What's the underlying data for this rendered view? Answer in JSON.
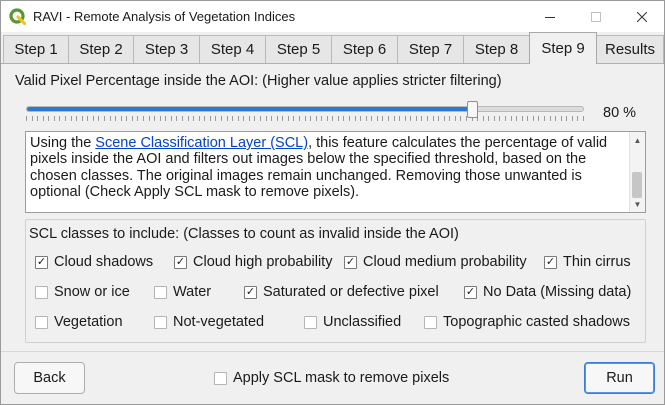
{
  "window": {
    "title": "RAVI - Remote Analysis of Vegetation Indices",
    "minimize_glyph": "—",
    "maximize_glyph": "☐",
    "close_glyph": "✕"
  },
  "tabs": [
    {
      "label": "Step 1",
      "active": false
    },
    {
      "label": "Step 2",
      "active": false
    },
    {
      "label": "Step 3",
      "active": false
    },
    {
      "label": "Step 4",
      "active": false
    },
    {
      "label": "Step 5",
      "active": false
    },
    {
      "label": "Step 6",
      "active": false
    },
    {
      "label": "Step 7",
      "active": false
    },
    {
      "label": "Step 8",
      "active": false
    },
    {
      "label": "Step 9",
      "active": true
    },
    {
      "label": "Results",
      "active": false
    }
  ],
  "threshold": {
    "label": "Valid Pixel Percentage inside the AOI: (Higher value applies stricter filtering)",
    "value_percent": 80,
    "value_text": "80 %"
  },
  "description": {
    "prefix": "Using the ",
    "link_text": "Scene Classification Layer (SCL)",
    "suffix": ", this feature calculates the percentage of valid pixels inside the AOI and filters out images below the specified threshold, based on the chosen classes. The original images remain unchanged. Removing those unwanted is optional (Check Apply SCL mask to remove pixels)."
  },
  "scl_classes": {
    "title": "SCL classes to include: (Classes to count as invalid inside the AOI)",
    "items": [
      {
        "label": "Cloud shadows",
        "checked": true
      },
      {
        "label": "Cloud high probability",
        "checked": true
      },
      {
        "label": "Cloud medium probability",
        "checked": true
      },
      {
        "label": "Thin cirrus",
        "checked": true
      },
      {
        "label": "Snow or ice",
        "checked": false
      },
      {
        "label": "Water",
        "checked": false
      },
      {
        "label": "Saturated or defective pixel",
        "checked": true
      },
      {
        "label": "No Data (Missing data)",
        "checked": true
      },
      {
        "label": "Vegetation",
        "checked": false
      },
      {
        "label": "Not-vegetated",
        "checked": false
      },
      {
        "label": "Unclassified",
        "checked": false
      },
      {
        "label": "Topographic casted shadows",
        "checked": false
      }
    ]
  },
  "apply_mask": {
    "label": "Apply SCL mask to remove pixels",
    "checked": false
  },
  "buttons": {
    "back": "Back",
    "run": "Run"
  },
  "colors": {
    "accent": "#2b78d6",
    "link": "#0044cc",
    "qgis_green": "#589632",
    "qgis_yellow": "#f0c419"
  }
}
